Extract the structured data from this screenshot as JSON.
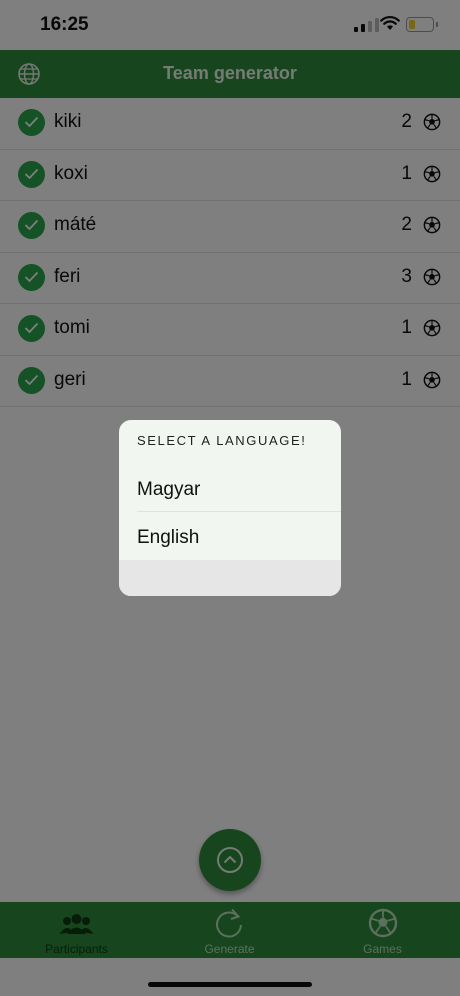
{
  "status_bar": {
    "time": "16:25"
  },
  "app_bar": {
    "title": "Team generator",
    "icon": "globe-icon"
  },
  "participants": [
    {
      "name": "kiki",
      "count": "2"
    },
    {
      "name": "koxi",
      "count": "1"
    },
    {
      "name": "máté",
      "count": "2"
    },
    {
      "name": "feri",
      "count": "3"
    },
    {
      "name": "tomi",
      "count": "1"
    },
    {
      "name": "geri",
      "count": "1"
    }
  ],
  "language_dialog": {
    "title": "SELECT A LANGUAGE!",
    "options": [
      "Magyar",
      "English"
    ]
  },
  "tabs": [
    {
      "label": "Participants",
      "icon": "people-icon",
      "active": true
    },
    {
      "label": "Generate",
      "icon": "refresh-icon",
      "active": false
    },
    {
      "label": "Games",
      "icon": "soccer-ball-icon",
      "active": false
    }
  ],
  "colors": {
    "primary": "#2e8b3a",
    "check": "#2aa54a",
    "dialog_bg": "#f1f7f0"
  }
}
